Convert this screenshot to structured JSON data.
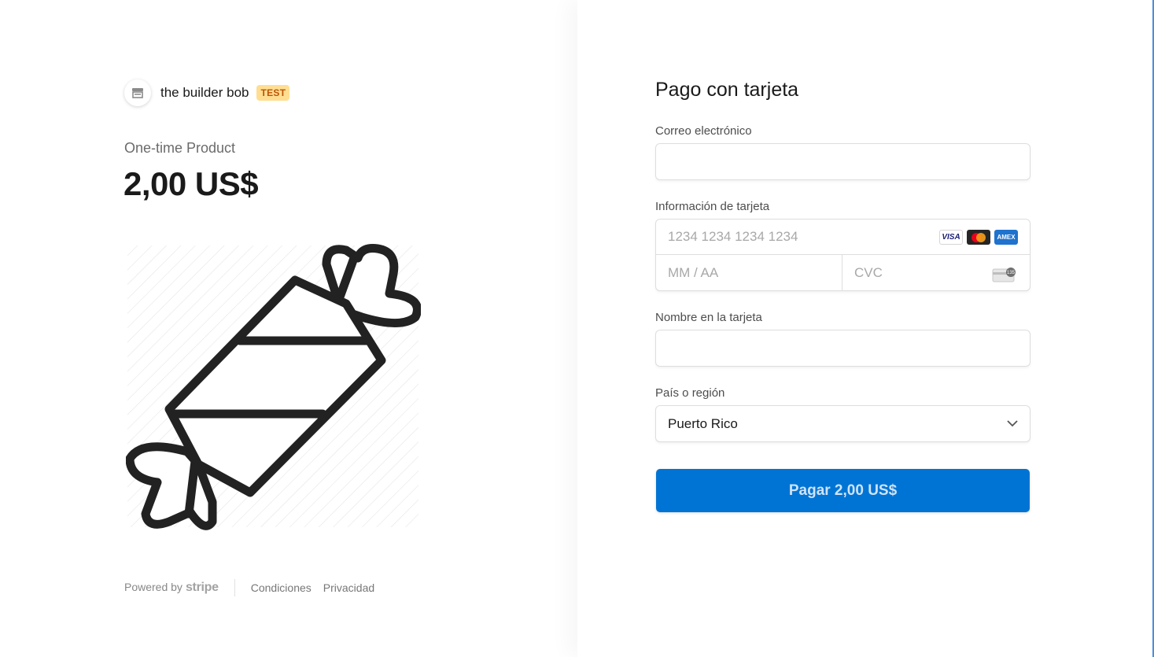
{
  "merchant": {
    "name": "the builder bob",
    "test_badge": "TEST",
    "avatar_icon": "store-icon"
  },
  "product": {
    "name": "One-time Product",
    "price": "2,00 US$",
    "image_icon": "candy-icon"
  },
  "footer": {
    "powered_by": "Powered by",
    "stripe": "stripe",
    "links": [
      "Condiciones",
      "Privacidad"
    ]
  },
  "form": {
    "title": "Pago con tarjeta",
    "email": {
      "label": "Correo electrónico",
      "value": "",
      "placeholder": ""
    },
    "card": {
      "label": "Información de tarjeta",
      "number_placeholder": "1234 1234 1234 1234",
      "expiry_placeholder": "MM / AA",
      "cvc_placeholder": "CVC",
      "brands": [
        "VISA",
        "mastercard",
        "AMEX"
      ],
      "cvc_icon_text": "135"
    },
    "name": {
      "label": "Nombre en la tarjeta",
      "value": ""
    },
    "country": {
      "label": "País o región",
      "value": "Puerto Rico"
    },
    "pay_button": "Pagar 2,00 US$"
  },
  "colors": {
    "accent": "#0074d4",
    "badge_bg": "#ffde92",
    "badge_text": "#bb5504"
  }
}
